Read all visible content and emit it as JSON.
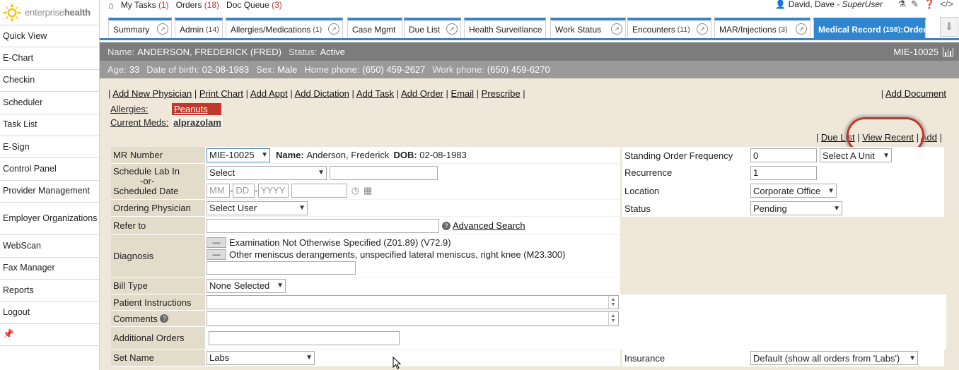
{
  "brand": {
    "name_light": "enterprise",
    "name_bold": "health"
  },
  "sidebar": {
    "items": [
      {
        "label": "Quick View"
      },
      {
        "label": "E-Chart"
      },
      {
        "label": "Checkin"
      },
      {
        "label": "Scheduler"
      },
      {
        "label": "Task List"
      },
      {
        "label": "E-Sign"
      },
      {
        "label": "Control Panel"
      },
      {
        "label": "Provider Management"
      },
      {
        "label": "Employer Organizations"
      },
      {
        "label": "WebScan"
      },
      {
        "label": "Fax Manager"
      },
      {
        "label": "Reports"
      },
      {
        "label": "Logout"
      }
    ],
    "pin_icon": "pin-icon"
  },
  "topbar": {
    "my_tasks": "My Tasks",
    "my_tasks_count": "(1)",
    "orders": "Orders",
    "orders_count": "(18)",
    "doc_queue": "Doc Queue",
    "doc_queue_count": "(3)",
    "user_name": "David, Dave - ",
    "user_role": "SuperUser"
  },
  "tabs": [
    {
      "label": "Summary",
      "count": ""
    },
    {
      "label": "Admin",
      "count": "(14)"
    },
    {
      "label": "Allergies/Medications",
      "count": "(1)"
    },
    {
      "label": "Case Mgmt",
      "count": ""
    },
    {
      "label": "Due List",
      "count": ""
    },
    {
      "label": "Health Surveillance",
      "count": ""
    },
    {
      "label": "Work Status",
      "count": ""
    },
    {
      "label": "Encounters",
      "count": "(11)"
    },
    {
      "label": "MAR/Injections",
      "count": "(3)"
    },
    {
      "label": "Medical Record",
      "count": "(158)",
      "suffix": ":Order"
    }
  ],
  "patient": {
    "name_label": "Name:",
    "name": "ANDERSON, FREDERICK (FRED)",
    "status_label": "Status:",
    "status": "Active",
    "mrn": "MIE-10025",
    "age_label": "Age:",
    "age": "33",
    "dob_label": "Date of birth:",
    "dob": "02-08-1983",
    "sex_label": "Sex:",
    "sex": "Male",
    "home_label": "Home phone:",
    "home_phone": "(650) 459-2627",
    "work_label": "Work phone:",
    "work_phone": "(650) 459-6270"
  },
  "actions": [
    "Add New Physician",
    "Print Chart",
    "Add Appt",
    "Add Dictation",
    "Add Task",
    "Add Order",
    "Email",
    "Prescribe"
  ],
  "add_document": "Add Document",
  "allergies": {
    "label": "Allergies",
    "value": "Peanuts",
    "meds_label": "Current Meds",
    "meds_value": "alprazolam"
  },
  "list_links": {
    "due_list": "Due List",
    "view_recent": "View Recent",
    "add": "Add"
  },
  "form": {
    "mr_number_label": "MR Number",
    "mr_number_value": "MIE-10025",
    "name_label": "Name:",
    "name_value": "Anderson, Frederick",
    "dob_label": "DOB:",
    "dob_value": "02-08-1983",
    "schedule_lab_label": "Schedule Lab In",
    "or_label": "-or-",
    "scheduled_date_label": "Scheduled Date",
    "schedule_select": "Select",
    "date_mm": "MM",
    "date_dd": "DD",
    "date_yyyy": "YYYY",
    "ordering_physician_label": "Ordering Physician",
    "ordering_physician_value": "Select User",
    "refer_to_label": "Refer to",
    "advanced_search": "Advanced Search",
    "diagnosis_label": "Diagnosis",
    "diagnoses": [
      "Examination Not Otherwise Specified (Z01.89) (V72.9)",
      "Other meniscus derangements, unspecified lateral meniscus, right knee (M23.300)"
    ],
    "bill_type_label": "Bill Type",
    "bill_type_value": "None Selected",
    "patient_instructions_label": "Patient Instructions",
    "comments_label": "Comments",
    "additional_orders_label": "Additional Orders",
    "set_name_label": "Set Name",
    "set_name_value": "Labs",
    "standing_freq_label": "Standing Order Frequency",
    "standing_freq_value": "0",
    "unit_value": "Select A Unit",
    "recurrence_label": "Recurrence",
    "recurrence_value": "1",
    "location_label": "Location",
    "location_value": "Corporate Office",
    "status_label": "Status",
    "status_value": "Pending",
    "insurance_label": "Insurance",
    "insurance_value": "Default (show all orders from 'Labs')"
  },
  "colors": {
    "accent": "#2f86d0",
    "alert": "#c0392b",
    "banner": "#7c7c7c",
    "panel": "#efe8da"
  }
}
